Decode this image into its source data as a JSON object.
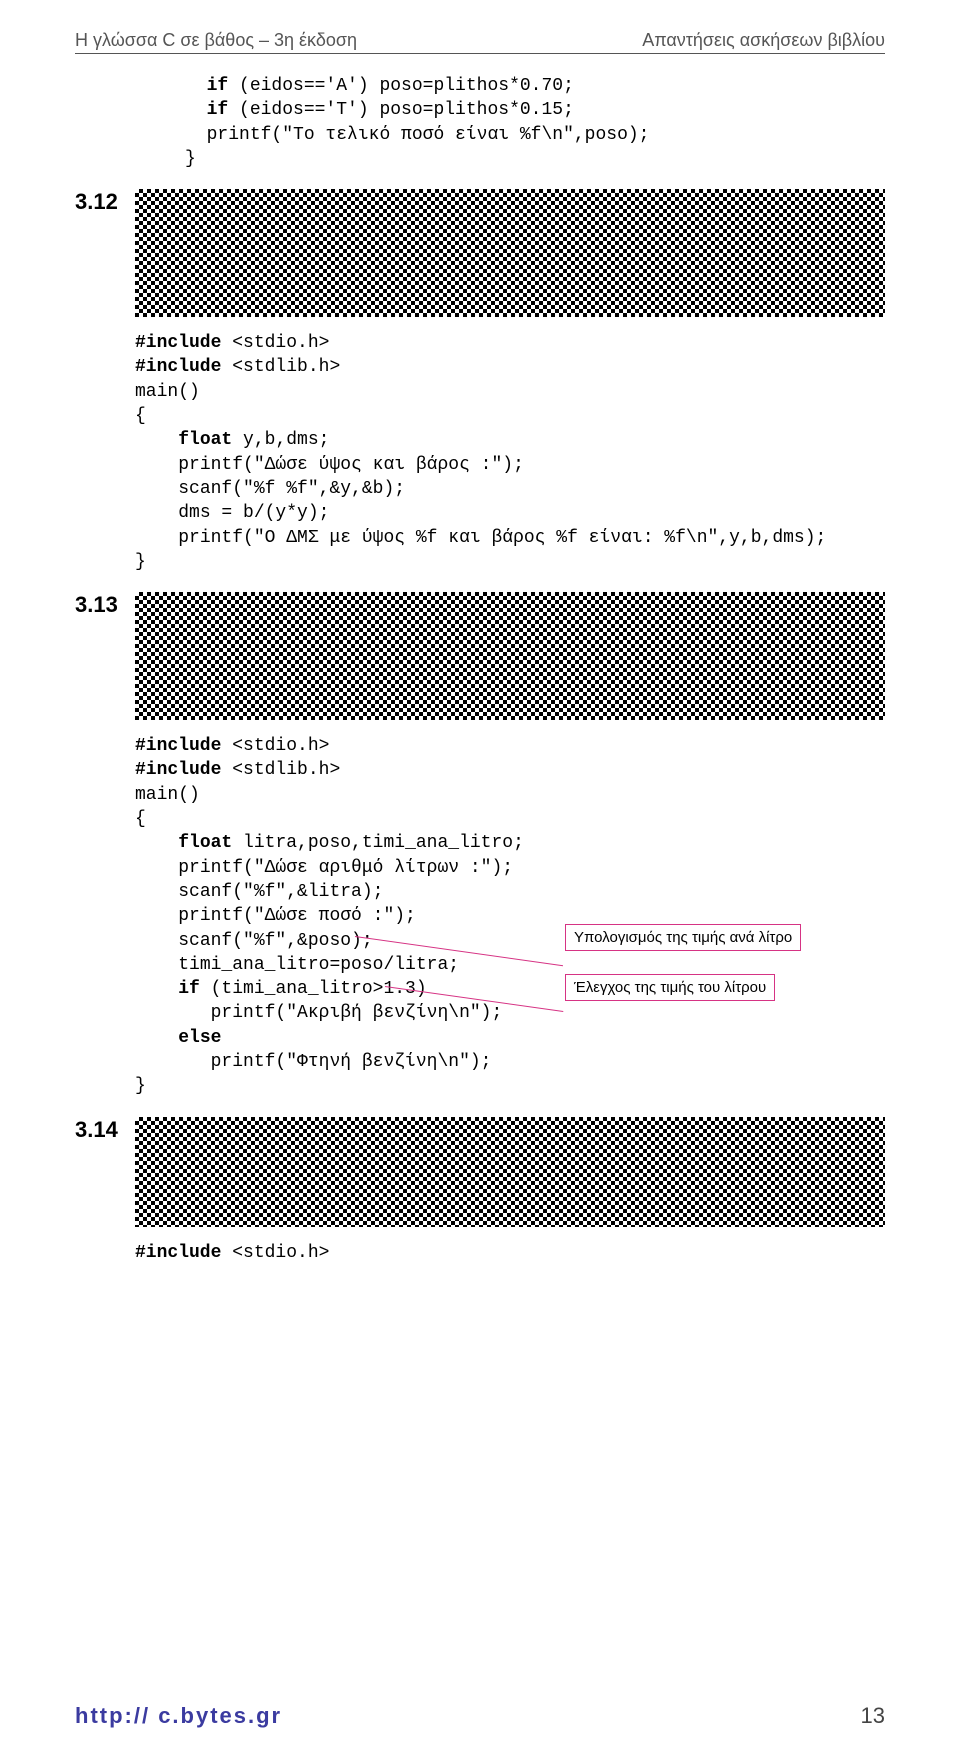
{
  "header": {
    "left": "Η γλώσσα C σε βάθος – 3η έκδοση",
    "right": "Απαντήσεις ασκήσεων βιβλίου"
  },
  "sections": {
    "s312": {
      "num": "3.12"
    },
    "s313": {
      "num": "3.13"
    },
    "s314": {
      "num": "3.14"
    }
  },
  "code_top": {
    "kw_if1": "if",
    "l1a": " (eidos=='A') poso=plithos*0.70;",
    "kw_if2": "if",
    "l2a": " (eidos=='T') poso=plithos*0.15;",
    "l3": "printf(\"Το τελικό ποσό είναι %f\\n\",poso);",
    "l4": "}"
  },
  "code_312": {
    "inc": "#include",
    "h1": " <stdio.h>",
    "h2": " <stdlib.h>",
    "mn": "main()",
    "ob": "{",
    "kw_float": "float",
    "l1": " y,b,dms;",
    "l2": "printf(\"Δώσε ύψος και βάρος :\");",
    "l3": "scanf(\"%f %f\",&y,&b);",
    "l4": "dms = b/(y*y);",
    "l5": "printf(\"Ο ΔΜΣ με ύψος %f και βάρος %f είναι: %f\\n\",y,b,dms);",
    "cb": "}"
  },
  "code_313": {
    "inc": "#include",
    "h1": " <stdio.h>",
    "h2": " <stdlib.h>",
    "mn": "main()",
    "ob": "{",
    "kw_float": "float",
    "l1": " litra,poso,timi_ana_litro;",
    "l2": "printf(\"Δώσε αριθμό λίτρων :\");",
    "l3": "scanf(\"%f\",&litra);",
    "l4": "printf(\"Δώσε ποσό :\");",
    "l5": "scanf(\"%f\",&poso);",
    "l6": "timi_ana_litro=poso/litra;",
    "kw_if": "if",
    "l7": " (timi_ana_litro>1.3)",
    "l8": "   printf(\"Ακριβή βενζίνη\\n\");",
    "kw_else": "else",
    "l9": "   printf(\"Φτηνή βενζίνη\\n\");",
    "cb": "}"
  },
  "code_314": {
    "inc": "#include",
    "h1": " <stdio.h>"
  },
  "annotations": {
    "a1": "Υπολογισμός της τιμής ανά λίτρο",
    "a2": "Έλεγχος της τιμής του λίτρου"
  },
  "footer": {
    "url": "http://  c.bytes.gr",
    "page": "13"
  }
}
